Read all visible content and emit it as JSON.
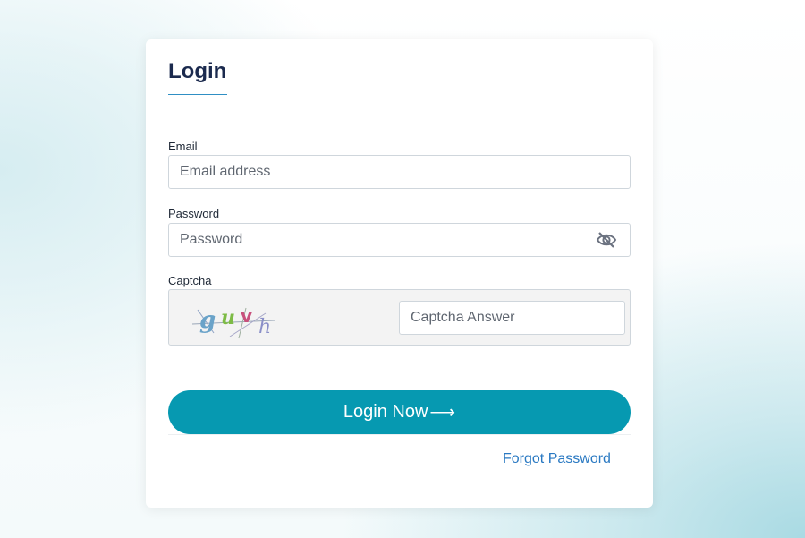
{
  "login": {
    "title": "Login",
    "email_label": "Email",
    "email_placeholder": "Email address",
    "password_label": "Password",
    "password_placeholder": "Password",
    "password_toggle_icon": "eye-slash-icon",
    "captcha_label": "Captcha",
    "captcha_text": "guvh",
    "captcha_placeholder": "Captcha Answer",
    "submit_label": "Login Now",
    "submit_icon": "arrow-right-icon",
    "forgot_link": "Forgot Password"
  },
  "colors": {
    "primary_button": "#0699b1",
    "title_text": "#1b2a4e",
    "link": "#2a79c2"
  }
}
